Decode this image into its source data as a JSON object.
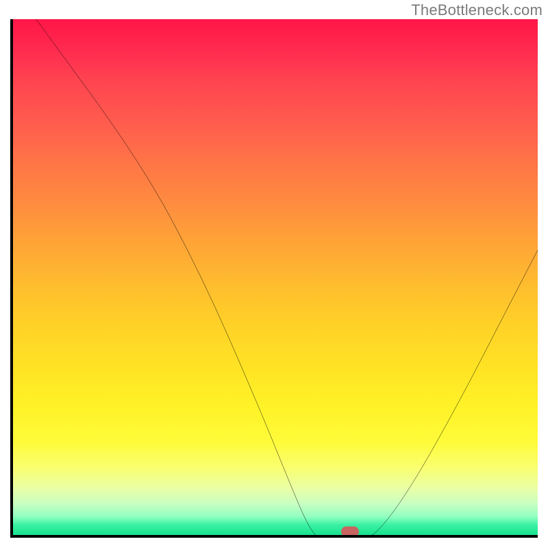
{
  "watermark": "TheBottleneck.com",
  "chart_data": {
    "type": "line",
    "title": "",
    "xlabel": "",
    "ylabel": "",
    "xlim": [
      0,
      100
    ],
    "ylim": [
      0,
      100
    ],
    "grid": false,
    "series": [
      {
        "name": "curve",
        "points": [
          {
            "x": 4.4,
            "y": 100.0
          },
          {
            "x": 24.5,
            "y": 72.5
          },
          {
            "x": 36.0,
            "y": 51.0
          },
          {
            "x": 46.5,
            "y": 27.0
          },
          {
            "x": 54.0,
            "y": 8.5
          },
          {
            "x": 56.5,
            "y": 3.0
          },
          {
            "x": 58.5,
            "y": 0.7
          },
          {
            "x": 62.0,
            "y": 0.5
          },
          {
            "x": 66.0,
            "y": 0.6
          },
          {
            "x": 69.5,
            "y": 2.0
          },
          {
            "x": 76.0,
            "y": 11.0
          },
          {
            "x": 85.0,
            "y": 27.0
          },
          {
            "x": 93.0,
            "y": 42.5
          },
          {
            "x": 100.0,
            "y": 56.0
          }
        ]
      }
    ],
    "marker": {
      "x": 64.2,
      "y": 0.6
    },
    "colors": {
      "gradient_top": "#ff1647",
      "gradient_mid": "#ffd327",
      "gradient_bottom": "#18e28e",
      "curve": "#000000",
      "marker": "#c86560"
    }
  }
}
